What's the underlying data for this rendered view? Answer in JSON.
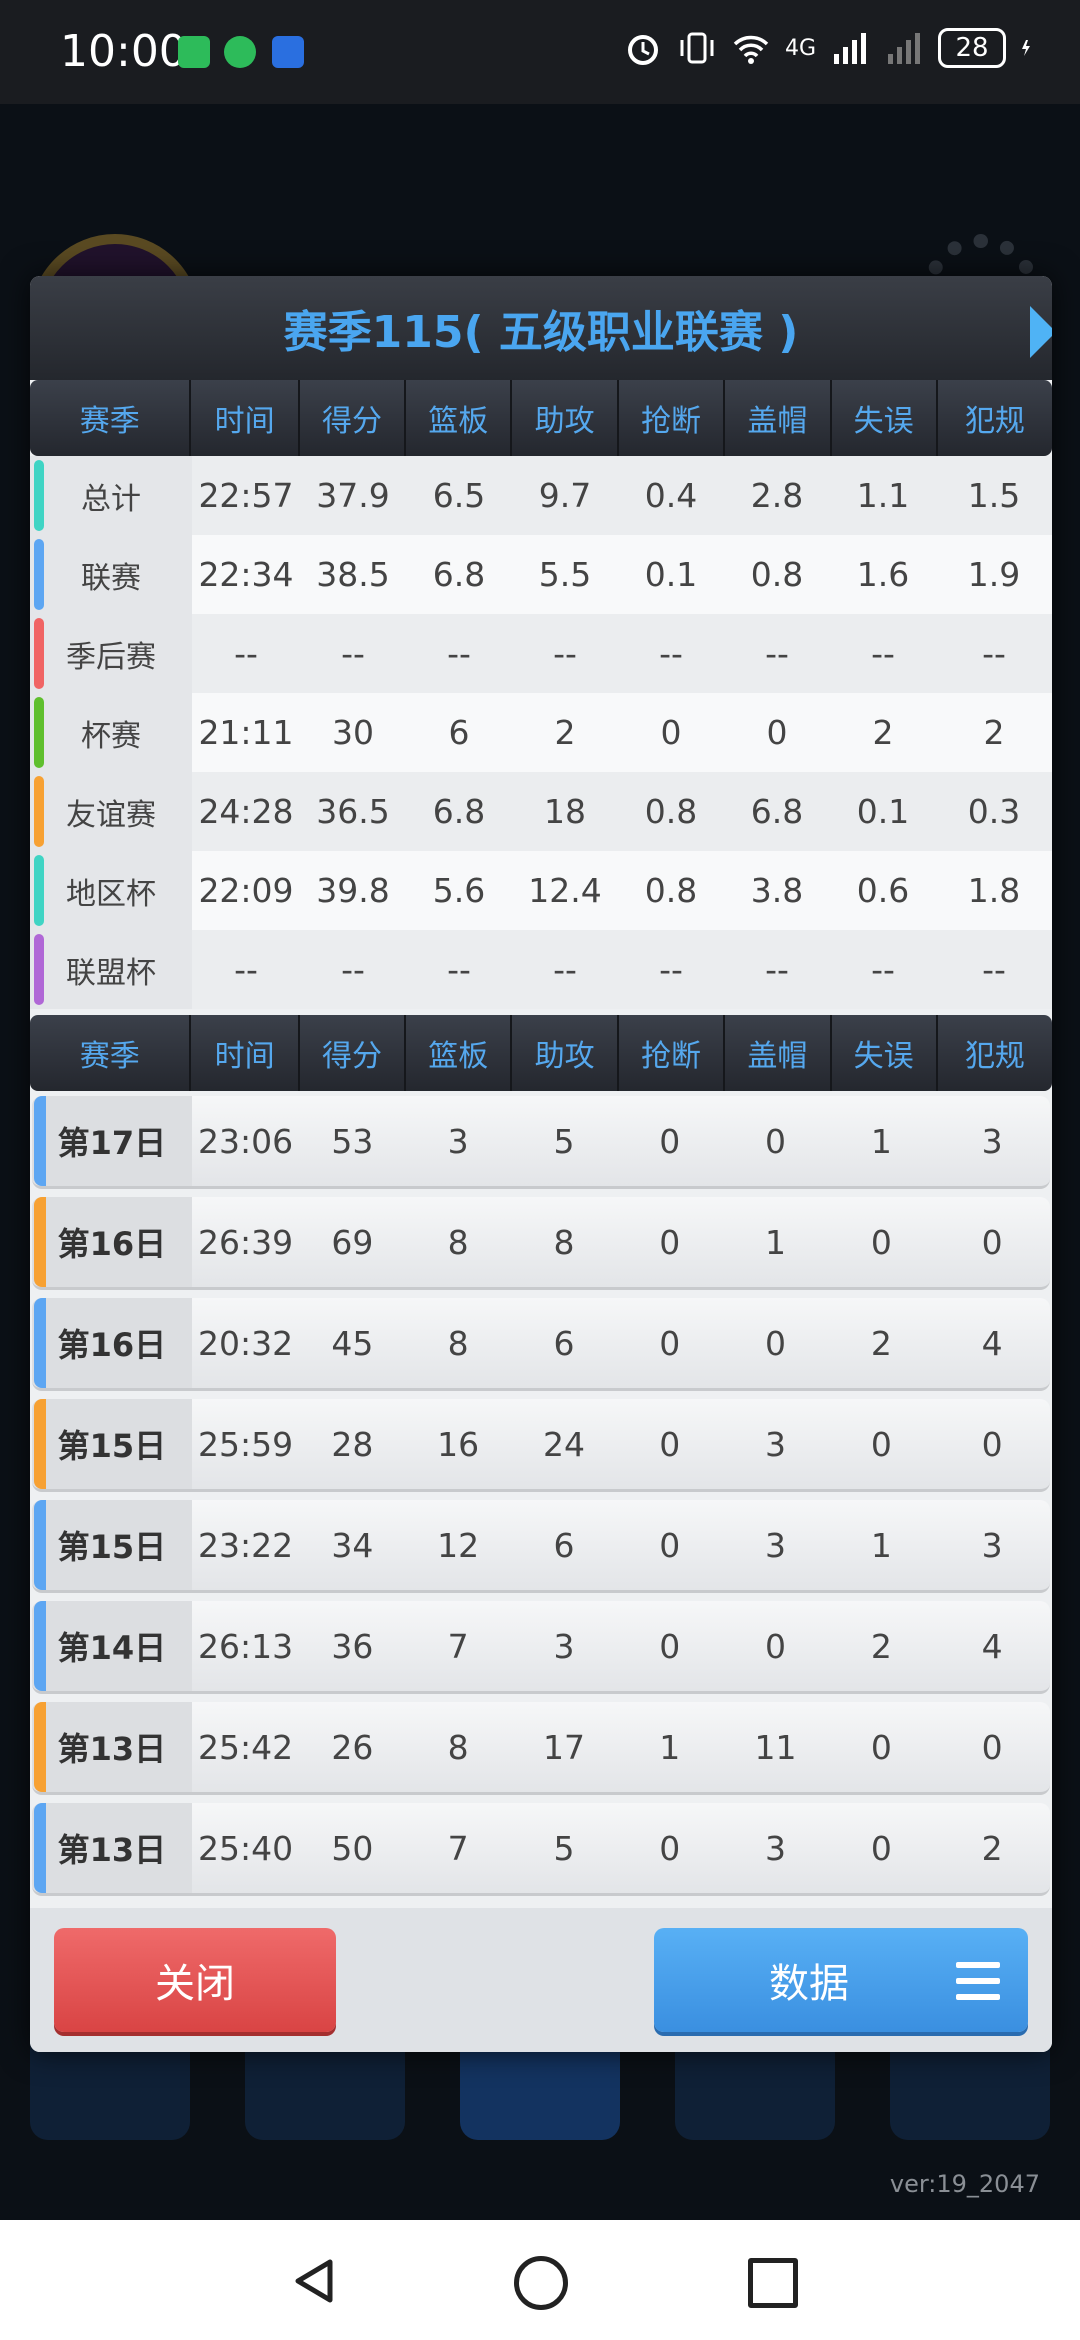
{
  "status_bar": {
    "time": "10:00",
    "battery": "28",
    "network": "4G",
    "icons": [
      "hourglass-app-icon",
      "wechat-icon",
      "car-app-icon",
      "alarm-icon",
      "vibrate-icon",
      "wifi-icon",
      "signal-icon",
      "no-signal-icon",
      "charging-icon"
    ]
  },
  "background": {
    "version": "ver:19_2047"
  },
  "dialog": {
    "title": "赛季115( 五级职业联赛 )",
    "headers": [
      "赛季",
      "时间",
      "得分",
      "篮板",
      "助攻",
      "抢断",
      "盖帽",
      "失误",
      "犯规"
    ],
    "season_rows": [
      {
        "label": "总计",
        "stripe": "#3fd4c4",
        "values": [
          "22:57",
          "37.9",
          "6.5",
          "9.7",
          "0.4",
          "2.8",
          "1.1",
          "1.5"
        ]
      },
      {
        "label": "联赛",
        "stripe": "#5da6f2",
        "values": [
          "22:34",
          "38.5",
          "6.8",
          "5.5",
          "0.1",
          "0.8",
          "1.6",
          "1.9"
        ]
      },
      {
        "label": "季后赛",
        "stripe": "#f06464",
        "values": [
          "--",
          "--",
          "--",
          "--",
          "--",
          "--",
          "--",
          "--"
        ]
      },
      {
        "label": "杯赛",
        "stripe": "#5fbf2e",
        "values": [
          "21:11",
          "30",
          "6",
          "2",
          "0",
          "0",
          "2",
          "2"
        ]
      },
      {
        "label": "友谊赛",
        "stripe": "#f7a133",
        "values": [
          "24:28",
          "36.5",
          "6.8",
          "18",
          "0.8",
          "6.8",
          "0.1",
          "0.3"
        ]
      },
      {
        "label": "地区杯",
        "stripe": "#3fd4c4",
        "values": [
          "22:09",
          "39.8",
          "5.6",
          "12.4",
          "0.8",
          "3.8",
          "0.6",
          "1.8"
        ]
      },
      {
        "label": "联盟杯",
        "stripe": "#b067d6",
        "values": [
          "--",
          "--",
          "--",
          "--",
          "--",
          "--",
          "--",
          "--"
        ]
      }
    ],
    "game_rows": [
      {
        "label": "第17日",
        "stripe": "#5da6f2",
        "values": [
          "23:06",
          "53",
          "3",
          "5",
          "0",
          "0",
          "1",
          "3"
        ]
      },
      {
        "label": "第16日",
        "stripe": "#f7a133",
        "values": [
          "26:39",
          "69",
          "8",
          "8",
          "0",
          "1",
          "0",
          "0"
        ]
      },
      {
        "label": "第16日",
        "stripe": "#5da6f2",
        "values": [
          "20:32",
          "45",
          "8",
          "6",
          "0",
          "0",
          "2",
          "4"
        ]
      },
      {
        "label": "第15日",
        "stripe": "#f7a133",
        "values": [
          "25:59",
          "28",
          "16",
          "24",
          "0",
          "3",
          "0",
          "0"
        ]
      },
      {
        "label": "第15日",
        "stripe": "#5da6f2",
        "values": [
          "23:22",
          "34",
          "12",
          "6",
          "0",
          "3",
          "1",
          "3"
        ]
      },
      {
        "label": "第14日",
        "stripe": "#5da6f2",
        "values": [
          "26:13",
          "36",
          "7",
          "3",
          "0",
          "0",
          "2",
          "4"
        ]
      },
      {
        "label": "第13日",
        "stripe": "#f7a133",
        "values": [
          "25:42",
          "26",
          "8",
          "17",
          "1",
          "11",
          "0",
          "0"
        ]
      },
      {
        "label": "第13日",
        "stripe": "#5da6f2",
        "values": [
          "25:40",
          "50",
          "7",
          "5",
          "0",
          "3",
          "0",
          "2"
        ]
      }
    ],
    "close_button": "关闭",
    "data_button": "数据"
  },
  "colors": {
    "title_blue": "#4aa6f0",
    "header_text": "#55a8ee",
    "close_red": "#e05252",
    "data_blue": "#4a9ff0"
  }
}
